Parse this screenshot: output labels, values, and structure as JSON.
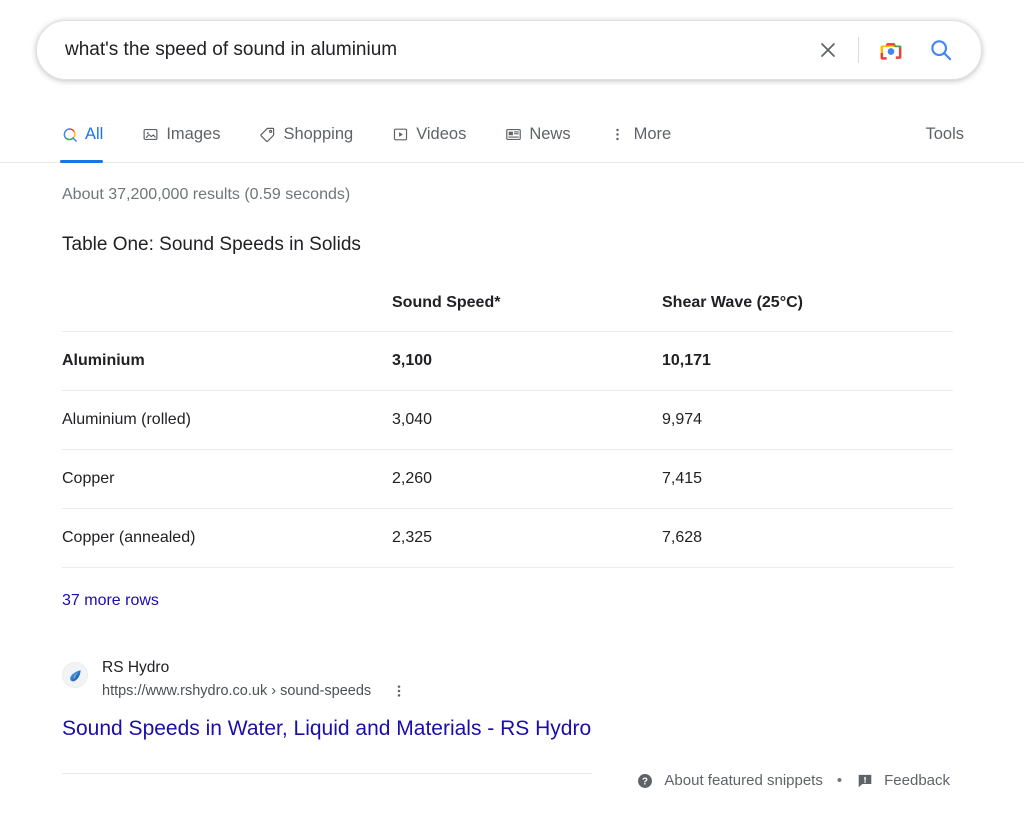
{
  "search": {
    "query": "what's the speed of sound in aluminium",
    "placeholder": "Search",
    "clear_icon": "close-icon",
    "lens_icon": "google-lens-camera-icon",
    "search_icon": "search-magnifier-icon"
  },
  "nav": {
    "tabs": [
      {
        "label": "All",
        "icon": "google-magnifier-icon",
        "active": true
      },
      {
        "label": "Images",
        "icon": "image-icon",
        "active": false
      },
      {
        "label": "Shopping",
        "icon": "price-tag-icon",
        "active": false
      },
      {
        "label": "Videos",
        "icon": "video-play-icon",
        "active": false
      },
      {
        "label": "News",
        "icon": "newspaper-icon",
        "active": false
      },
      {
        "label": "More",
        "icon": "more-vertical-dots-icon",
        "active": false
      }
    ],
    "tools_label": "Tools"
  },
  "result_stats": "About 37,200,000 results (0.59 seconds)",
  "snippet": {
    "title": "Table One: Sound Speeds in Solids",
    "table": {
      "headers": [
        "",
        "Sound Speed*",
        "Shear Wave (25°C)"
      ],
      "rows": [
        {
          "name": "Aluminium",
          "sound_speed": "3,100",
          "shear_wave": "10,171",
          "bold": true
        },
        {
          "name": "Aluminium (rolled)",
          "sound_speed": "3,040",
          "shear_wave": "9,974",
          "bold": false
        },
        {
          "name": "Copper",
          "sound_speed": "2,260",
          "shear_wave": "7,415",
          "bold": false
        },
        {
          "name": "Copper (annealed)",
          "sound_speed": "2,325",
          "shear_wave": "7,628",
          "bold": false
        }
      ],
      "more_rows_label": "37 more rows"
    },
    "source": {
      "name": "RS Hydro",
      "url": "https://www.rshydro.co.uk › sound-speeds",
      "favicon": "water-drop-icon",
      "kebab_icon": "more-vertical-dots-icon"
    },
    "result_title": "Sound Speeds in Water, Liquid and Materials - RS Hydro",
    "footer": {
      "about_label": "About featured snippets",
      "about_icon": "help-question-circle-icon",
      "separator": "•",
      "feedback_label": "Feedback",
      "feedback_icon": "feedback-flag-icon"
    }
  },
  "colors": {
    "link": "#1a0dab",
    "active_tab": "#1a73e8",
    "text": "#202124",
    "muted": "#70757a"
  }
}
